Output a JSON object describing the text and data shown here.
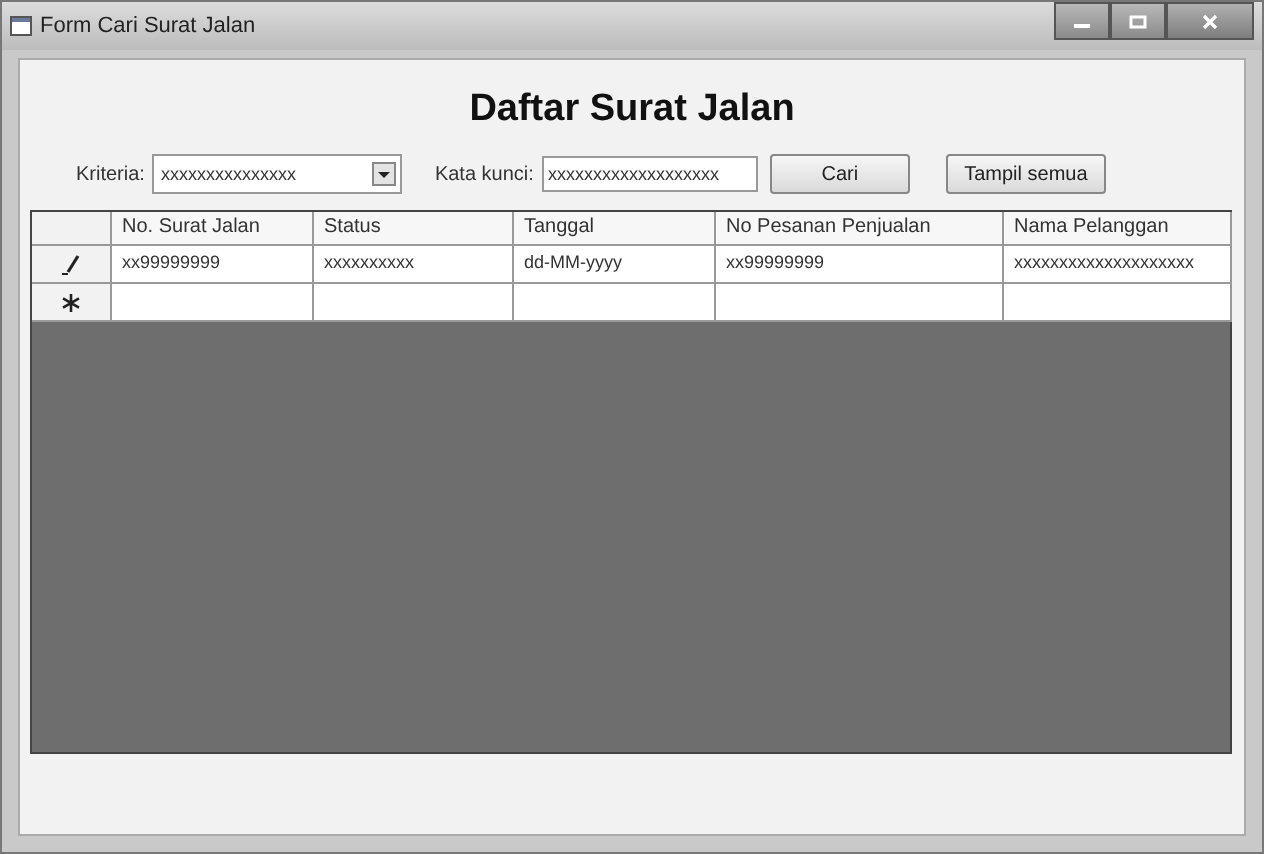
{
  "window": {
    "title": "Form Cari Surat Jalan"
  },
  "heading": "Daftar Surat Jalan",
  "search": {
    "criteria_label": "Kriteria:",
    "criteria_value": "xxxxxxxxxxxxxxx",
    "keyword_label": "Kata kunci:",
    "keyword_value": "xxxxxxxxxxxxxxxxxxx",
    "buttons": [
      "Cari",
      "Tampil semua"
    ]
  },
  "table": {
    "columns": [
      "No. Surat Jalan",
      "Status",
      "Tanggal",
      "No Pesanan Penjualan",
      "Nama Pelanggan"
    ],
    "rows": [
      {
        "kind": "edit",
        "cells": [
          "xx99999999",
          "xxxxxxxxxx",
          "dd-MM-yyyy",
          "xx99999999",
          "xxxxxxxxxxxxxxxxxxxx"
        ]
      },
      {
        "kind": "new",
        "cells": [
          "",
          "",
          "",
          "",
          ""
        ]
      }
    ]
  }
}
